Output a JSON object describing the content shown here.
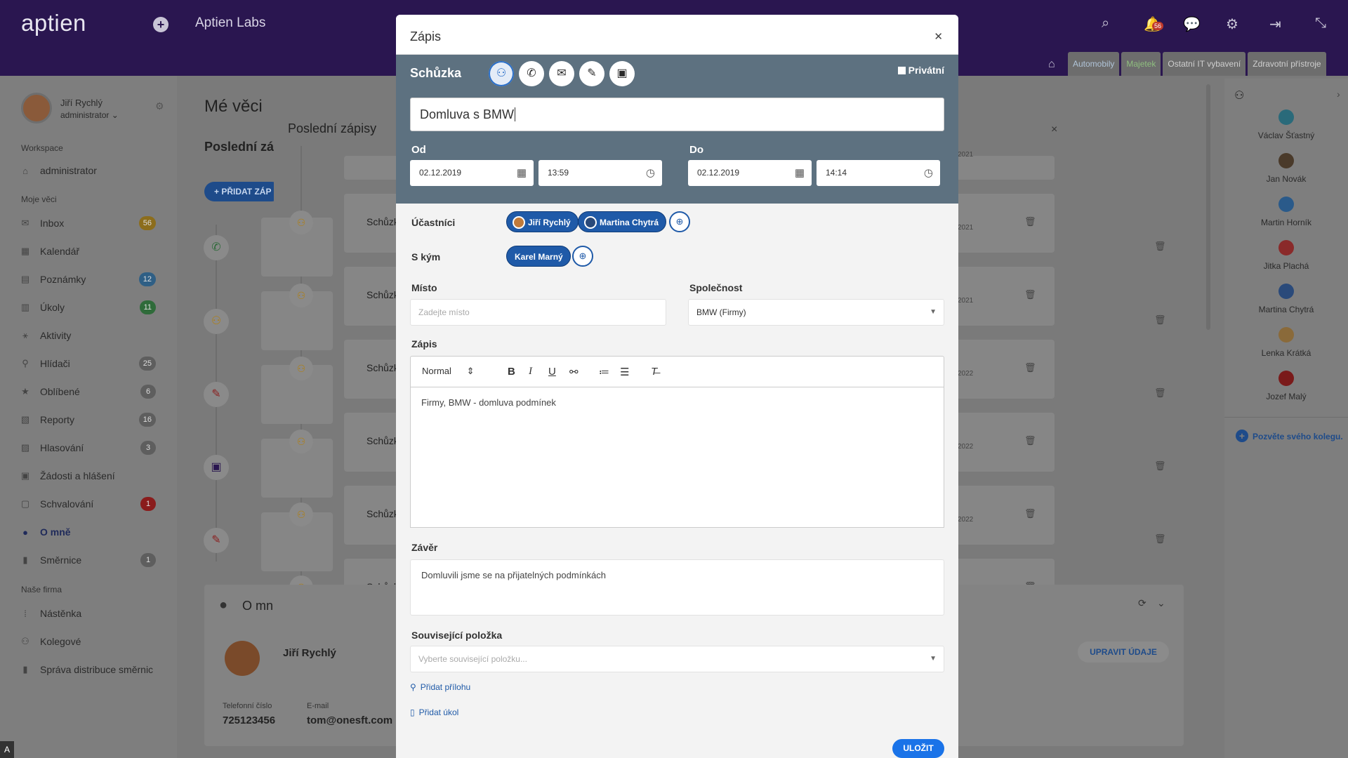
{
  "app": {
    "logo": "aptien",
    "company": "Aptien Labs",
    "notifications_count": "56"
  },
  "top_tabs": [
    "Automobily",
    "Majetek",
    "Ostatní IT vybavení",
    "Zdravotní přístroje"
  ],
  "user": {
    "name": "Jiří Rychlý",
    "role": "administrator"
  },
  "sidebar": {
    "workspace_head": "Workspace",
    "workspace_item": "administrator",
    "mine_head": "Moje věci",
    "items": [
      {
        "label": "Inbox",
        "badge": "56"
      },
      {
        "label": "Kalendář",
        "badge": ""
      },
      {
        "label": "Poznámky",
        "badge": "12"
      },
      {
        "label": "Úkoly",
        "badge": "11"
      },
      {
        "label": "Aktivity",
        "badge": ""
      },
      {
        "label": "Hlídači",
        "badge": "25"
      },
      {
        "label": "Oblíbené",
        "badge": "6"
      },
      {
        "label": "Reporty",
        "badge": "16"
      },
      {
        "label": "Hlasování",
        "badge": "3"
      },
      {
        "label": "Žádosti a hlášení",
        "badge": ""
      },
      {
        "label": "Schvalování",
        "badge": "1"
      },
      {
        "label": "O mně",
        "badge": ""
      },
      {
        "label": "Směrnice",
        "badge": "1"
      }
    ],
    "company_head": "Naše firma",
    "company_items": [
      "Nástěnka",
      "Kolegové",
      "Správa distribuce směrnic"
    ]
  },
  "main": {
    "title": "Mé věci",
    "recent_title": "Poslední záp",
    "add_button": "+ PŘIDAT ZÁP",
    "panel_title": "Poslední zápisy",
    "card_label": "Schůzk",
    "date_snippets": [
      "2021",
      "2021",
      "2021",
      "2022",
      "2022",
      "2022",
      "2022"
    ]
  },
  "people": [
    "Václav Šťastný",
    "Jan Novák",
    "Martin Horník",
    "Jitka Plachá",
    "Martina Chytrá",
    "Lenka Krátká",
    "Jozef Malý"
  ],
  "invite": "Pozvěte svého kolegu.",
  "about": {
    "title": "O mn",
    "name": "Jiří Rychlý",
    "phone_label": "Telefonní číslo",
    "phone": "725123456",
    "email_label": "E-mail",
    "email": "tom@onesft.com",
    "edit_button": "UPRAVIT ÚDAJE"
  },
  "modal": {
    "title": "Zápis",
    "type_label": "Schůzka",
    "private_label": "Privátní",
    "subject": "Domluva s BMW",
    "from_label": "Od",
    "to_label": "Do",
    "from_date": "02.12.2019",
    "from_time": "13:59",
    "to_date": "02.12.2019",
    "to_time": "14:14",
    "participants_label": "Účastníci",
    "participants": [
      "Jiří Rychlý",
      "Martina Chytrá"
    ],
    "with_label": "S kým",
    "with": [
      "Karel Marný"
    ],
    "place_label": "Místo",
    "place_placeholder": "Zadejte místo",
    "company_label": "Společnost",
    "company_value": "BMW (Firmy)",
    "note_label": "Zápis",
    "format_select": "Normal",
    "note_text": "Firmy, BMW - domluva podmínek",
    "conclusion_label": "Závěr",
    "conclusion_text": "Domluvili jsme se na přijatelných podmínkách",
    "related_label": "Související položka",
    "related_placeholder": "Vyberte související položku...",
    "add_attachment": "Přidat přílohu",
    "add_task": "Přidat úkol",
    "save_button": "ULOŽIT"
  }
}
